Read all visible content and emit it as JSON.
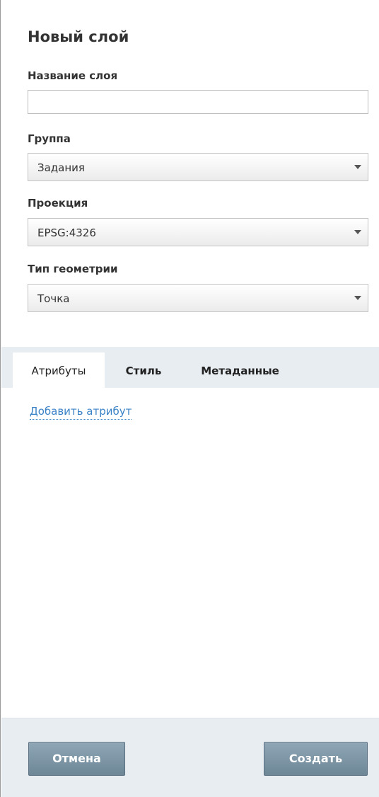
{
  "form": {
    "title": "Новый слой",
    "name_label": "Название слоя",
    "name_value": "",
    "group_label": "Группа",
    "group_value": "Задания",
    "projection_label": "Проекция",
    "projection_value": "EPSG:4326",
    "geometry_label": "Тип геометрии",
    "geometry_value": "Точка"
  },
  "tabs": [
    {
      "label": "Атрибуты",
      "active": true
    },
    {
      "label": "Стиль",
      "active": false
    },
    {
      "label": "Метаданные",
      "active": false
    }
  ],
  "attributes": {
    "add_link": "Добавить атрибут"
  },
  "footer": {
    "cancel_label": "Отмена",
    "create_label": "Создать"
  },
  "colors": {
    "link": "#3a82c6",
    "button": "#7b93a3",
    "tabbar_bg": "#e8edf1",
    "footer_bg": "#e8edf1"
  },
  "icons": {
    "dropdown": "chevron-down-icon"
  }
}
